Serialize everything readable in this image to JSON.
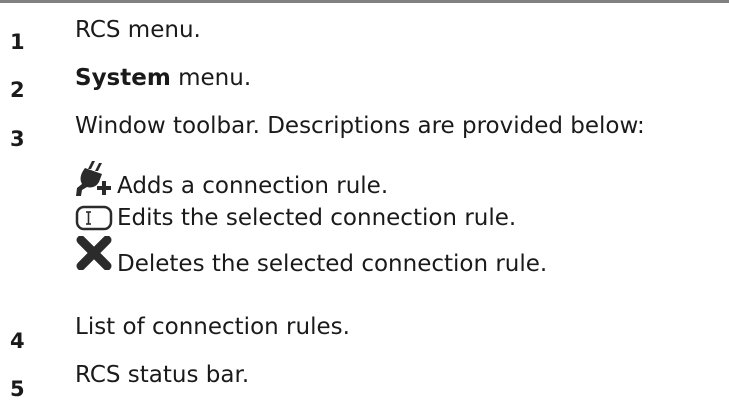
{
  "items": [
    {
      "number": "1",
      "text": "RCS menu."
    },
    {
      "number": "2",
      "bold": "System",
      "text": " menu."
    },
    {
      "number": "3",
      "text": "Window toolbar. Descriptions are provided below:"
    },
    {
      "number": "4",
      "text": "List of connection rules."
    },
    {
      "number": "5",
      "text": "RCS status bar."
    }
  ],
  "toolbar_items": [
    {
      "icon": "add-connection-rule-icon",
      "text": "Adds a connection rule."
    },
    {
      "icon": "edit-icon",
      "text": "Edits the selected connection rule."
    },
    {
      "icon": "delete-icon",
      "text": "Deletes the selected connection rule."
    }
  ],
  "colors": {
    "text": "#1a1a1a",
    "rule": "#808080",
    "icon": "#2b2b2b"
  }
}
